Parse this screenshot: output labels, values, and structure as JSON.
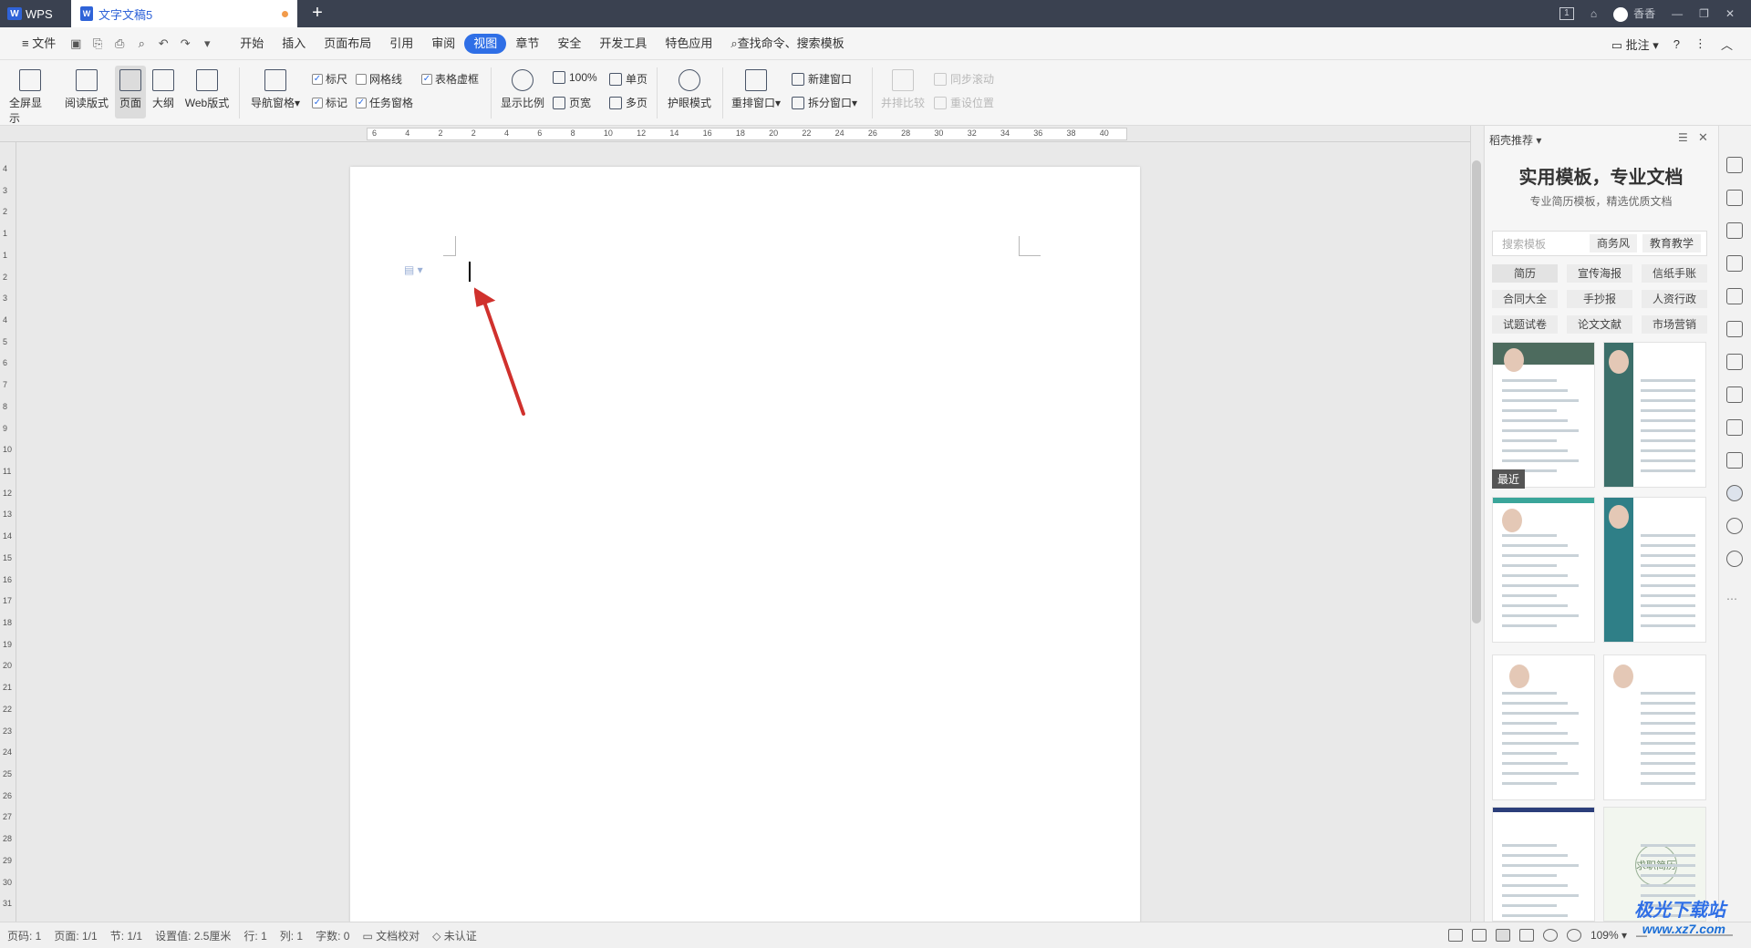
{
  "titlebar": {
    "app_name": "WPS",
    "doc_tab": "文字文稿5",
    "new_tab": "+",
    "page_badge": "1",
    "user": "香香"
  },
  "menubar": {
    "file": "文件",
    "tabs": [
      "开始",
      "插入",
      "页面布局",
      "引用",
      "审阅",
      "视图",
      "章节",
      "安全",
      "开发工具",
      "特色应用"
    ],
    "active_tab": "视图",
    "search": "查找命令、搜索模板",
    "comment": "批注",
    "help": "?"
  },
  "ribbon": {
    "full_screen": "全屏显示",
    "reading_layout": "阅读版式",
    "page": "页面",
    "outline": "大纲",
    "web_layout": "Web版式",
    "nav_pane": "导航窗格",
    "ruler": "标尺",
    "gridlines": "网格线",
    "table_virtual": "表格虚框",
    "marks": "标记",
    "task_pane": "任务窗格",
    "zoom_ratio": "显示比例",
    "zoom_100": "100%",
    "page_width": "页宽",
    "single_page": "单页",
    "multi_page": "多页",
    "eye_protect": "护眼模式",
    "rearrange_window": "重排窗口",
    "new_window": "新建窗口",
    "split_window": "拆分窗口",
    "side_by_side": "并排比较",
    "sync_scroll": "同步滚动",
    "reset_position": "重设位置",
    "checks": {
      "ruler": true,
      "gridlines": false,
      "table_virtual": true,
      "marks": true,
      "task_pane": true
    }
  },
  "ruler": {
    "h_ticks": [
      "6",
      "4",
      "2",
      "2",
      "4",
      "6",
      "8",
      "10",
      "12",
      "14",
      "16",
      "18",
      "20",
      "22",
      "24",
      "26",
      "28",
      "30",
      "32",
      "34",
      "36",
      "38",
      "40"
    ],
    "v_ticks": [
      "4",
      "3",
      "2",
      "1",
      "1",
      "2",
      "3",
      "4",
      "5",
      "6",
      "7",
      "8",
      "9",
      "10",
      "11",
      "12",
      "13",
      "14",
      "15",
      "16",
      "17",
      "18",
      "19",
      "20",
      "21",
      "22",
      "23",
      "24",
      "25",
      "26",
      "27",
      "28",
      "29",
      "30",
      "31"
    ]
  },
  "panel": {
    "header": "稻壳推荐",
    "title": "实用模板，专业文档",
    "subtitle": "专业简历模板，精选优质文档",
    "search_placeholder": "搜索模板",
    "search_tags": [
      "商务风",
      "教育教学"
    ],
    "categories": [
      "简历",
      "宣传海报",
      "信纸手账",
      "合同大全",
      "手抄报",
      "人资行政",
      "试题试卷",
      "论文文献",
      "市场营销"
    ],
    "recent_label": "最近",
    "card_text": "求职简历"
  },
  "status": {
    "page_num": "页码: 1",
    "pages": "页面: 1/1",
    "section": "节: 1/1",
    "setting": "设置值: 2.5厘米",
    "row": "行: 1",
    "col": "列: 1",
    "words": "字数: 0",
    "proofread": "文档校对",
    "auth": "未认证",
    "zoom": "109%"
  },
  "watermark": {
    "brand": "极光下载站",
    "site": "www.xz7.com"
  },
  "colors": {
    "accent": "#2f6fe6",
    "titlebar": "#3a4150",
    "arrow": "#d0312d"
  }
}
